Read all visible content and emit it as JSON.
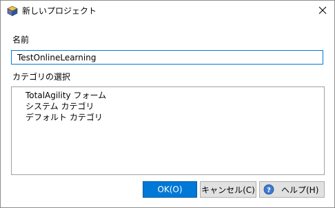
{
  "window": {
    "title": "新しいプロジェクト"
  },
  "name_field": {
    "label": "名前",
    "value": "TestOnlineLearning"
  },
  "category": {
    "label": "カテゴリの選択",
    "items": [
      "TotalAgility フォーム",
      "システム カテゴリ",
      "デフォルト カテゴリ"
    ]
  },
  "buttons": {
    "ok": "OK(O)",
    "cancel": "キャンセル(C)",
    "help": "ヘルプ(H)"
  },
  "icons": {
    "app": "project-cube-icon",
    "close": "close-icon",
    "help": "help-icon"
  },
  "colors": {
    "accent": "#0078d7",
    "button_bg": "#e1e1e1"
  }
}
